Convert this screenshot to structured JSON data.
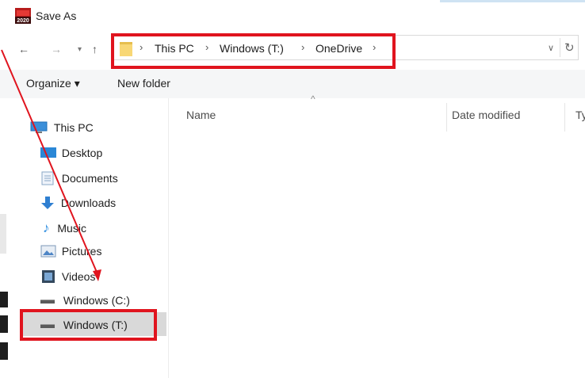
{
  "window": {
    "title": "Save As",
    "app_icon_label": "2020"
  },
  "nav": {
    "back_icon": "arrow-left-icon",
    "forward_icon": "arrow-right-icon",
    "recent_icon": "chevron-down-icon",
    "up_icon": "arrow-up-icon"
  },
  "address_bar": {
    "breadcrumbs": [
      "This PC",
      "Windows (T:)",
      "OneDrive"
    ],
    "separator": "›",
    "dropdown_icon": "chevron-down-icon",
    "refresh_icon": "refresh-icon"
  },
  "toolbar": {
    "organize_label": "Organize ▾",
    "new_folder_label": "New folder"
  },
  "sidebar": {
    "items": [
      {
        "label": "This PC",
        "icon": "pc-icon"
      },
      {
        "label": "Desktop",
        "icon": "desktop-icon"
      },
      {
        "label": "Documents",
        "icon": "documents-icon"
      },
      {
        "label": "Downloads",
        "icon": "downloads-icon"
      },
      {
        "label": "Music",
        "icon": "music-icon"
      },
      {
        "label": "Pictures",
        "icon": "pictures-icon"
      },
      {
        "label": "Videos",
        "icon": "videos-icon"
      },
      {
        "label": "Windows (C:)",
        "icon": "drive-icon"
      },
      {
        "label": "Windows (T:)",
        "icon": "drive-icon"
      }
    ],
    "selected": "Windows (T:)"
  },
  "file_list": {
    "columns": [
      "Name",
      "Date modified",
      "Ty"
    ],
    "rows": []
  },
  "annotation": {
    "color": "#e0141e"
  }
}
